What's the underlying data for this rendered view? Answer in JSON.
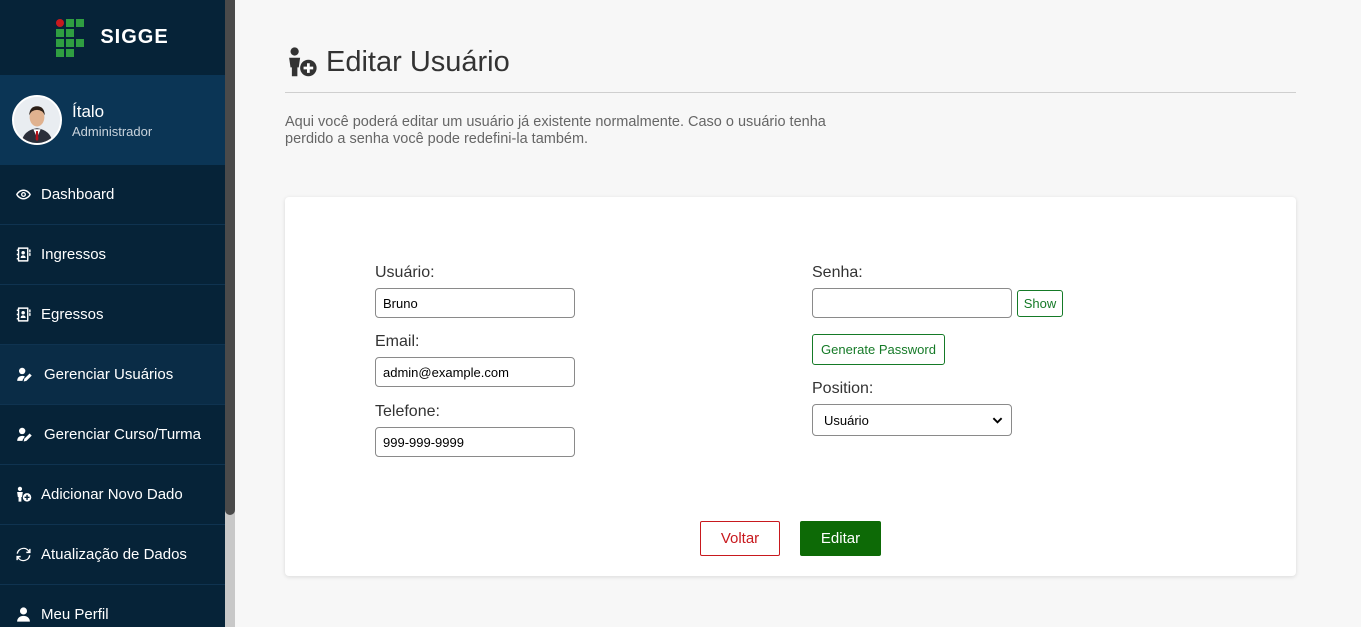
{
  "brand": {
    "name": "SIGGE"
  },
  "profile": {
    "name": "Ítalo",
    "role": "Administrador"
  },
  "sidebar": {
    "items": [
      {
        "label": "Dashboard",
        "icon": "eye-icon"
      },
      {
        "label": "Ingressos",
        "icon": "contact-book-icon"
      },
      {
        "label": "Egressos",
        "icon": "contact-book-icon"
      },
      {
        "label": "Gerenciar Usuários",
        "icon": "user-edit-icon"
      },
      {
        "label": "Gerenciar Curso/Turma",
        "icon": "user-edit-icon"
      },
      {
        "label": "Adicionar Novo Dado",
        "icon": "user-add-icon"
      },
      {
        "label": "Atualização de Dados",
        "icon": "refresh-icon"
      },
      {
        "label": "Meu Perfil",
        "icon": "user-icon"
      }
    ]
  },
  "page": {
    "title": "Editar Usuário",
    "description": "Aqui você poderá editar um usuário já existente normalmente. Caso o usuário tenha perdido a senha você pode redefini-la também."
  },
  "form": {
    "usuario_label": "Usuário:",
    "usuario_value": "Bruno",
    "email_label": "Email:",
    "email_value": "admin@example.com",
    "telefone_label": "Telefone:",
    "telefone_value": "999-999-9999",
    "senha_label": "Senha:",
    "senha_value": "",
    "show_label": "Show",
    "generate_label": "Generate Password",
    "position_label": "Position:",
    "position_value": "Usuário",
    "voltar_label": "Voltar",
    "editar_label": "Editar"
  },
  "colors": {
    "sidebar_bg": "#062338",
    "profile_bg": "#0b3555",
    "accent_green": "#0d6a06",
    "outline_green": "#157a27",
    "cancel_red": "#c8191e"
  }
}
